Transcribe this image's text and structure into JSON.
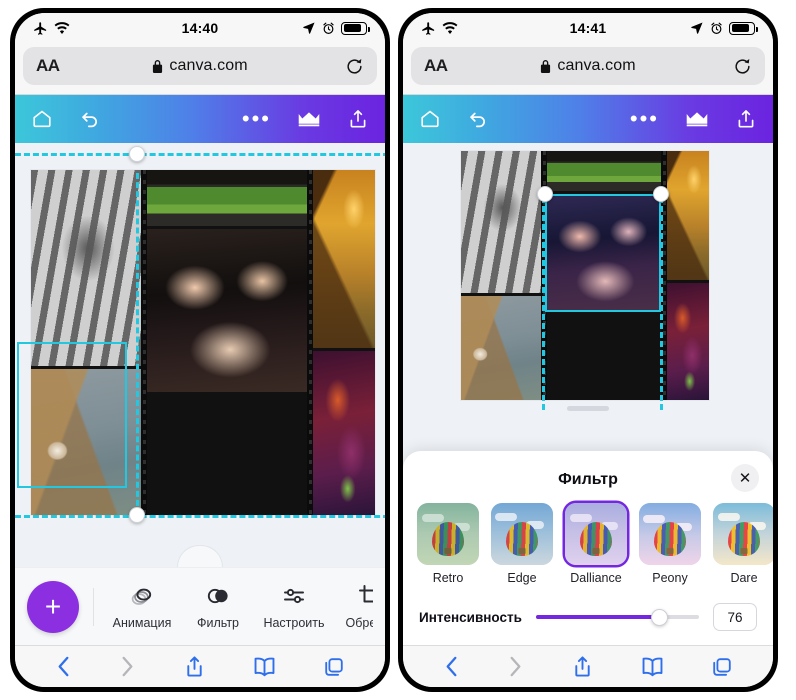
{
  "left_phone": {
    "status_bar": {
      "airplane_icon": "airplane-mode-icon",
      "wifi_icon": "wifi-icon",
      "time": "14:40",
      "location_icon": "location-arrow-icon",
      "alarm_icon": "alarm-clock-icon",
      "battery_icon": "battery-icon"
    },
    "browser": {
      "text_size_label": "AA",
      "lock_icon": "lock-icon",
      "url": "canva.com",
      "reload_icon": "reload-icon"
    },
    "canva_header": {
      "home_icon": "home-icon",
      "undo_icon": "undo-icon",
      "more_label": "•••",
      "crown_icon": "crown-icon",
      "share_icon": "share-upload-icon"
    },
    "canvas": {
      "photos": [
        {
          "name": "cat-paw",
          "style": "ph-catpaw"
        },
        {
          "name": "stone-house",
          "style": "ph-house"
        },
        {
          "name": "rottweiler-dog",
          "style": "ph-dog"
        },
        {
          "name": "sky-clouds",
          "style": "ph-sky"
        },
        {
          "name": "sunflower",
          "style": "ph-sunflower"
        },
        {
          "name": "flying-owl",
          "style": "ph-owl"
        },
        {
          "name": "autumn-forest",
          "style": "ph-autumn"
        },
        {
          "name": "nebula-space",
          "style": "ph-nebula"
        }
      ],
      "selection": "whole-collage-selected"
    },
    "toolbar": {
      "add_label": "+",
      "items": [
        {
          "label": "Анимация",
          "icon": "animation-icon"
        },
        {
          "label": "Фильтр",
          "icon": "filter-icon"
        },
        {
          "label": "Настроить",
          "icon": "adjust-sliders-icon"
        },
        {
          "label": "Обрезка",
          "icon": "crop-icon"
        }
      ]
    },
    "safari_bar": {
      "back_icon": "back-chevron-icon",
      "forward_icon": "forward-chevron-icon",
      "share_icon": "share-icon",
      "bookmarks_icon": "bookmarks-book-icon",
      "tabs_icon": "tabs-icon"
    }
  },
  "right_phone": {
    "status_bar": {
      "airplane_icon": "airplane-mode-icon",
      "wifi_icon": "wifi-icon",
      "time": "14:41",
      "location_icon": "location-arrow-icon",
      "alarm_icon": "alarm-clock-icon",
      "battery_icon": "battery-icon"
    },
    "browser": {
      "text_size_label": "AA",
      "lock_icon": "lock-icon",
      "url": "canva.com",
      "reload_icon": "reload-icon"
    },
    "canva_header": {
      "home_icon": "home-icon",
      "undo_icon": "undo-icon",
      "more_label": "•••",
      "crown_icon": "crown-icon",
      "share_icon": "share-upload-icon"
    },
    "canvas": {
      "photos": [
        {
          "name": "cat-paw",
          "style": "ph-catpaw"
        },
        {
          "name": "stone-house",
          "style": "ph-house"
        },
        {
          "name": "rottweiler-dog-filtered",
          "style": "ph-dog-filtered"
        },
        {
          "name": "sky-clouds",
          "style": "ph-sky"
        },
        {
          "name": "sunflower",
          "style": "ph-sunflower"
        },
        {
          "name": "flying-owl",
          "style": "ph-owl"
        },
        {
          "name": "autumn-forest",
          "style": "ph-autumn"
        },
        {
          "name": "nebula-space",
          "style": "ph-nebula"
        }
      ],
      "selection": "dog-photo-selected"
    },
    "filter_panel": {
      "title": "Фильтр",
      "close_icon": "close-x-icon",
      "filters": [
        {
          "label": "Retro",
          "selected": false,
          "tint": "#8fbfa6",
          "sky": "#b8d8c8",
          "ground": "#e4eed0"
        },
        {
          "label": "Edge",
          "selected": false,
          "tint": "#a9c6e2",
          "sky": "#8fb6dd",
          "ground": "#dfe6ea"
        },
        {
          "label": "Dalliance",
          "selected": true,
          "tint": "#cbbbe8",
          "sky": "#c5c8ea",
          "ground": "#eee3f4"
        },
        {
          "label": "Peony",
          "selected": false,
          "tint": "#e7c8e6",
          "sky": "#9dc2ea",
          "ground": "#f4e1ef"
        },
        {
          "label": "Dare",
          "selected": false,
          "tint": "#f0dfc0",
          "sky": "#96c6e6",
          "ground": "#f6ecd6"
        },
        {
          "label": "",
          "selected": false,
          "tint": "#dfe6ee",
          "sky": "#9dc2e8",
          "ground": "#eef1f5"
        }
      ],
      "intensity": {
        "label": "Интенсивность",
        "value": "76",
        "percent": 76,
        "accent_color": "#7526e0"
      }
    },
    "safari_bar": {
      "back_icon": "back-chevron-icon",
      "forward_icon": "forward-chevron-icon",
      "share_icon": "share-icon",
      "bookmarks_icon": "bookmarks-book-icon",
      "tabs_icon": "tabs-icon"
    }
  },
  "theme": {
    "canva_gradient_start": "#3cc7da",
    "canva_gradient_end": "#6b23e0",
    "accent_purple": "#7526e0",
    "fab_purple": "#8b2fe0",
    "selection_cyan": "#23c8e0",
    "safari_blue": "#2f6fec",
    "page_background": "#eef1f5"
  }
}
